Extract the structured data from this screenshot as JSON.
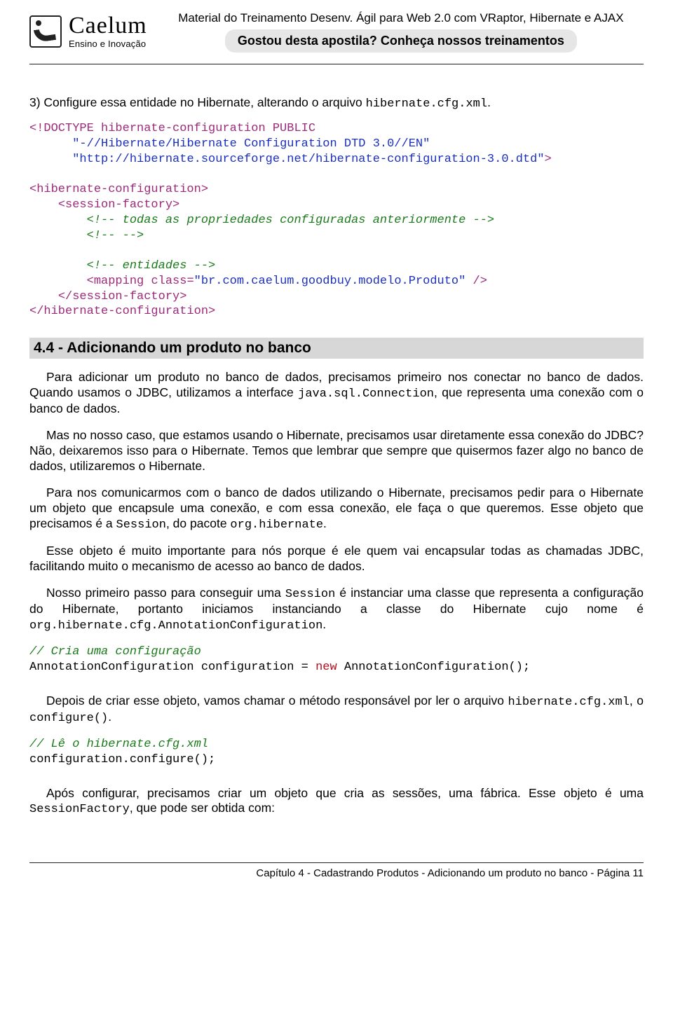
{
  "header": {
    "logoName": "Caelum",
    "logoTag": "Ensino e Inovação",
    "courseLine": "Material do Treinamento Desenv. Ágil para Web 2.0 com VRaptor, Hibernate e AJAX",
    "cta": "Gostou desta apostila? Conheça nossos treinamentos"
  },
  "step": {
    "prefix": "3) Configure essa entidade no Hibernate, alterando o arquivo ",
    "file": "hibernate.cfg.xml",
    "suffix": "."
  },
  "codeBlock1": {
    "l1a": "<!DOCTYPE hibernate-configuration PUBLIC",
    "l2s": "\"-//Hibernate/Hibernate Configuration DTD 3.0//EN\"",
    "l3s": "\"http://hibernate.sourceforge.net/hibernate-configuration-3.0.dtd\"",
    "l3b": ">",
    "l5": "<hibernate-configuration>",
    "l6": "<session-factory>",
    "l7": "<!-- todas as propriedades configuradas anteriormente -->",
    "l8": "<!-- -->",
    "l10": "<!-- entidades -->",
    "l11a": "<mapping ",
    "l11b": "class=",
    "l11s": "\"br.com.caelum.goodbuy.modelo.Produto\"",
    "l11c": " />",
    "l12": "</session-factory>",
    "l13": "</hibernate-configuration>"
  },
  "sectionTitle": "4.4 - Adicionando um produto no banco",
  "p1": {
    "a": "Para adicionar um produto no banco de dados, precisamos primeiro nos conectar no banco de dados. Quando usamos o JDBC, utilizamos a interface ",
    "c1": "java.sql.Connection",
    "b": ", que representa uma conexão com o banco de dados."
  },
  "p2": "Mas no nosso caso, que estamos usando o Hibernate, precisamos usar diretamente essa conexão do JDBC? Não, deixaremos isso para o Hibernate. Temos que lembrar que sempre que quisermos fazer algo no banco de dados, utilizaremos o Hibernate.",
  "p3": {
    "a": "Para nos comunicarmos com o banco de dados utilizando o Hibernate, precisamos pedir para o Hibernate um objeto que encapsule uma conexão, e com essa conexão, ele faça o que queremos.  Esse objeto que precisamos é a ",
    "c1": "Session",
    "b": ", do pacote ",
    "c2": "org.hibernate",
    "c": "."
  },
  "p4": "Esse objeto é muito importante para nós porque é ele quem vai encapsular todas as chamadas JDBC, facilitando muito o mecanismo de acesso ao banco de dados.",
  "p5": {
    "a": "Nosso primeiro passo para conseguir uma ",
    "c1": "Session",
    "b": " é instanciar uma classe que representa a configuração do Hibernate, portanto iniciamos instanciando a classe do Hibernate cujo nome é ",
    "c2": "org.hibernate.cfg.AnnotationConfiguration",
    "c": "."
  },
  "codeBlock2": {
    "c1": "// Cria uma configuração",
    "l1a": "AnnotationConfiguration configuration = ",
    "l1new": "new",
    "l1b": " AnnotationConfiguration();"
  },
  "p6": {
    "a": "Depois de criar esse objeto, vamos chamar o método responsável por ler o arquivo ",
    "c1": "hibernate.cfg.xml",
    "b": ", o ",
    "c2": "configure()",
    "c": "."
  },
  "codeBlock3": {
    "c1": "// Lê o hibernate.cfg.xml",
    "l1": "configuration.configure();"
  },
  "p7": {
    "a": "Após configurar, precisamos criar um objeto que cria as sessões, uma fábrica.  Esse objeto é uma ",
    "c1": "SessionFactory",
    "b": ", que pode ser obtida com:"
  },
  "footer": "Capítulo 4 - Cadastrando Produtos - Adicionando um produto no banco - Página 11"
}
